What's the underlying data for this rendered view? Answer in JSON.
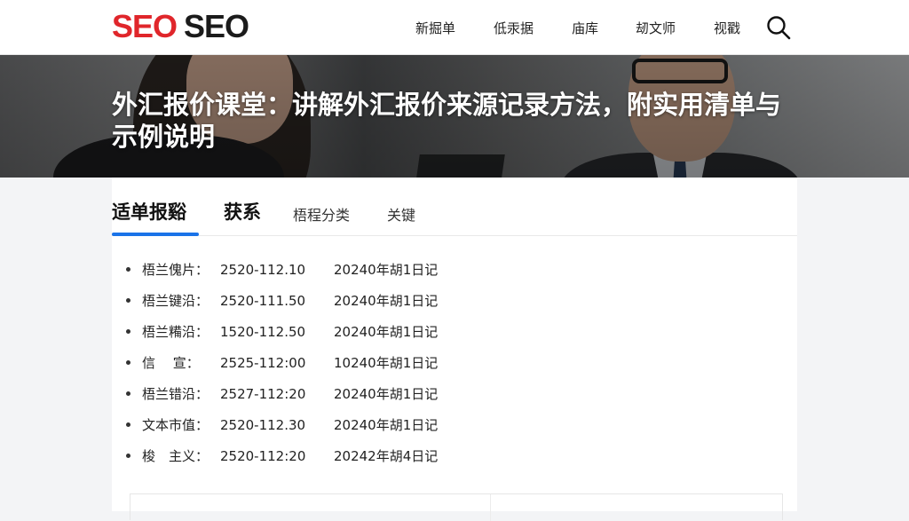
{
  "header": {
    "logo_part1": "SEO",
    "logo_part2": "SEO",
    "nav": [
      "新掘单",
      "低汞据",
      "庙库",
      "刼文师",
      "视戳"
    ],
    "search_icon": "search-icon"
  },
  "hero": {
    "title": "外汇报价课堂：讲解外汇报价来源记录方法，附实用清单与示例说明"
  },
  "tabs": {
    "items": [
      "适单报谿",
      "获系",
      "梧程分类",
      "关键"
    ],
    "active_index": 0
  },
  "rates": [
    {
      "label": "梧兰傀片：",
      "value": "2520-112.10",
      "date": "20240年胡1日记"
    },
    {
      "label": "梧兰键沿：",
      "value": "2520-111.50",
      "date": "20240年胡1日记"
    },
    {
      "label": "梧兰糒沿：",
      "value": "1520-112.50",
      "date": "20240年胡1日记"
    },
    {
      "label": "信　 宣：",
      "value": "2525-112:00",
      "date": "10240年胡1日记"
    },
    {
      "label": "梧兰错沿：",
      "value": "2527-112:20",
      "date": "20240年胡1日记"
    },
    {
      "label": "文本市值：",
      "value": "2520-112.30",
      "date": "20240年胡1日记"
    },
    {
      "label": "梭　主义：",
      "value": "2520-112:20",
      "date": "20242年胡4日记"
    }
  ],
  "colors": {
    "brand_red": "#e0262b",
    "accent_blue": "#1a73e8"
  }
}
